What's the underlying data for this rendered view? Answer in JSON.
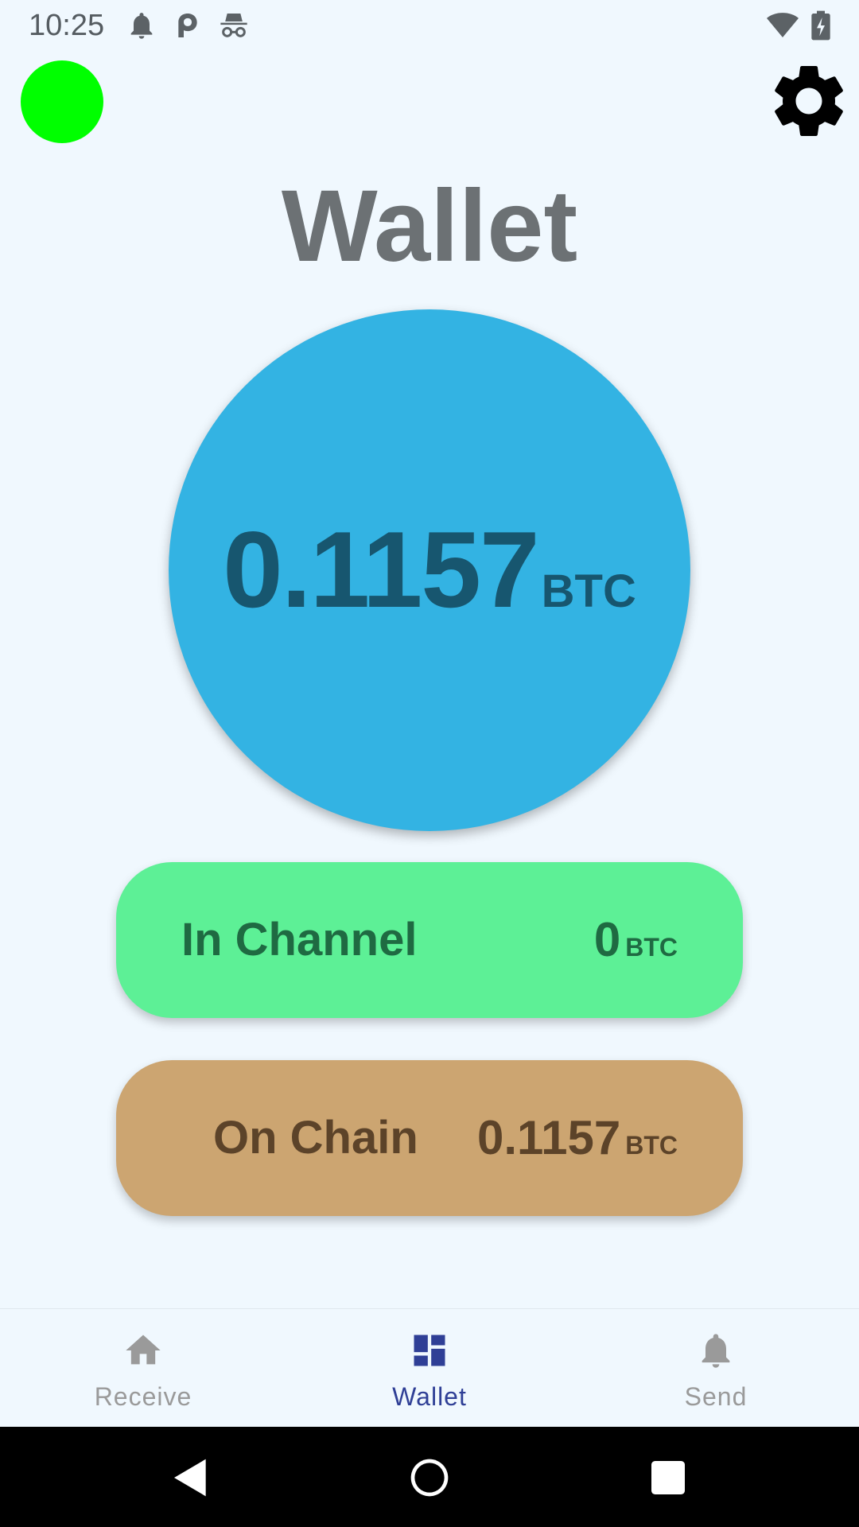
{
  "status_bar": {
    "time": "10:25",
    "icons": [
      "notification-bell-icon",
      "p-app-icon",
      "incognito-icon",
      "wifi-icon",
      "battery-charging-icon"
    ]
  },
  "header": {
    "title": "Wallet",
    "status_indicator_color": "#00ff00",
    "settings_icon": "gear-icon"
  },
  "balance": {
    "amount": "0.1157",
    "unit": "BTC",
    "circle_color": "#33b3e3"
  },
  "in_channel": {
    "label": "In Channel",
    "amount": "0",
    "unit": "BTC",
    "color": "#5df096"
  },
  "on_chain": {
    "label": "On Chain",
    "amount": "0.1157",
    "unit": "BTC",
    "color": "#cca571"
  },
  "bottom_nav": {
    "items": [
      {
        "label": "Receive",
        "icon": "home-icon",
        "active": false
      },
      {
        "label": "Wallet",
        "icon": "dashboard-icon",
        "active": true
      },
      {
        "label": "Send",
        "icon": "bell-icon",
        "active": false
      }
    ],
    "active_color": "#2f3f96",
    "inactive_color": "#9a9a9a"
  },
  "system_nav": {
    "buttons": [
      "back-icon",
      "home-circle-icon",
      "recents-icon"
    ]
  }
}
